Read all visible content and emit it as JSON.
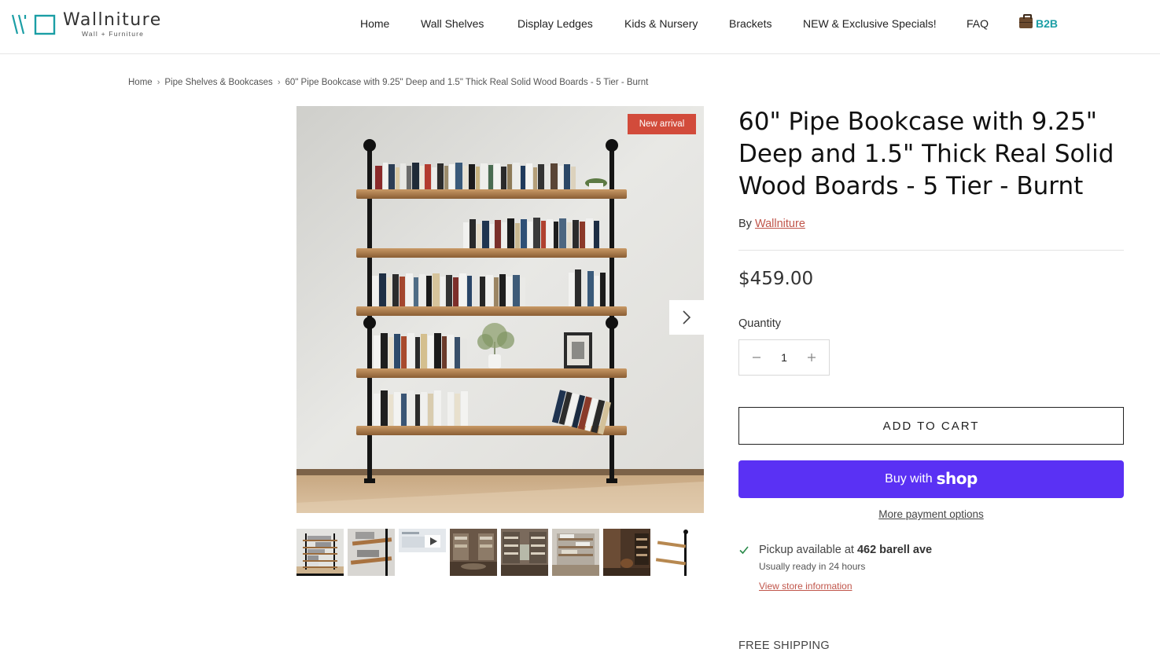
{
  "brand": {
    "name": "Wallniture",
    "tagline": "Wall + Furniture",
    "accent_color": "#1b9ea5",
    "logo_icon": "wallniture-logo-icon"
  },
  "nav": {
    "items": [
      {
        "label": "Home"
      },
      {
        "label": "Wall Shelves"
      },
      {
        "label": "Display Ledges"
      },
      {
        "label": "Kids & Nursery"
      },
      {
        "label": "Brackets"
      },
      {
        "label": "NEW & Exclusive Specials!"
      },
      {
        "label": "FAQ"
      }
    ],
    "b2b_label": "B2B",
    "b2b_icon": "briefcase-icon"
  },
  "breadcrumb": {
    "home": "Home",
    "category": "Pipe Shelves & Bookcases",
    "current": "60\" Pipe Bookcase with 9.25\" Deep and 1.5\" Thick Real Solid Wood Boards - 5 Tier - Burnt"
  },
  "gallery": {
    "badge": "New arrival",
    "badge_color": "#d24b3b",
    "next_icon": "chevron-right-icon",
    "thumbnail_count": 8,
    "active_thumbnail": 1
  },
  "product": {
    "title": "60\" Pipe Bookcase with 9.25\" Deep and 1.5\" Thick Real Solid Wood Boards - 5 Tier - Burnt",
    "by_label": "By",
    "vendor": "Wallniture",
    "price": "$459.00",
    "quantity_label": "Quantity",
    "quantity": "1",
    "add_to_cart": "ADD TO CART",
    "buy_with": "Buy with",
    "shop_brand": "shop",
    "shop_color": "#5a31f4",
    "more_payment": "More payment options",
    "pickup_prefix": "Pickup available at",
    "pickup_location": "462 barell ave",
    "pickup_ready": "Usually ready in 24 hours",
    "store_info": "View store information",
    "free_shipping": "FREE SHIPPING",
    "link_color": "#c0554a"
  }
}
